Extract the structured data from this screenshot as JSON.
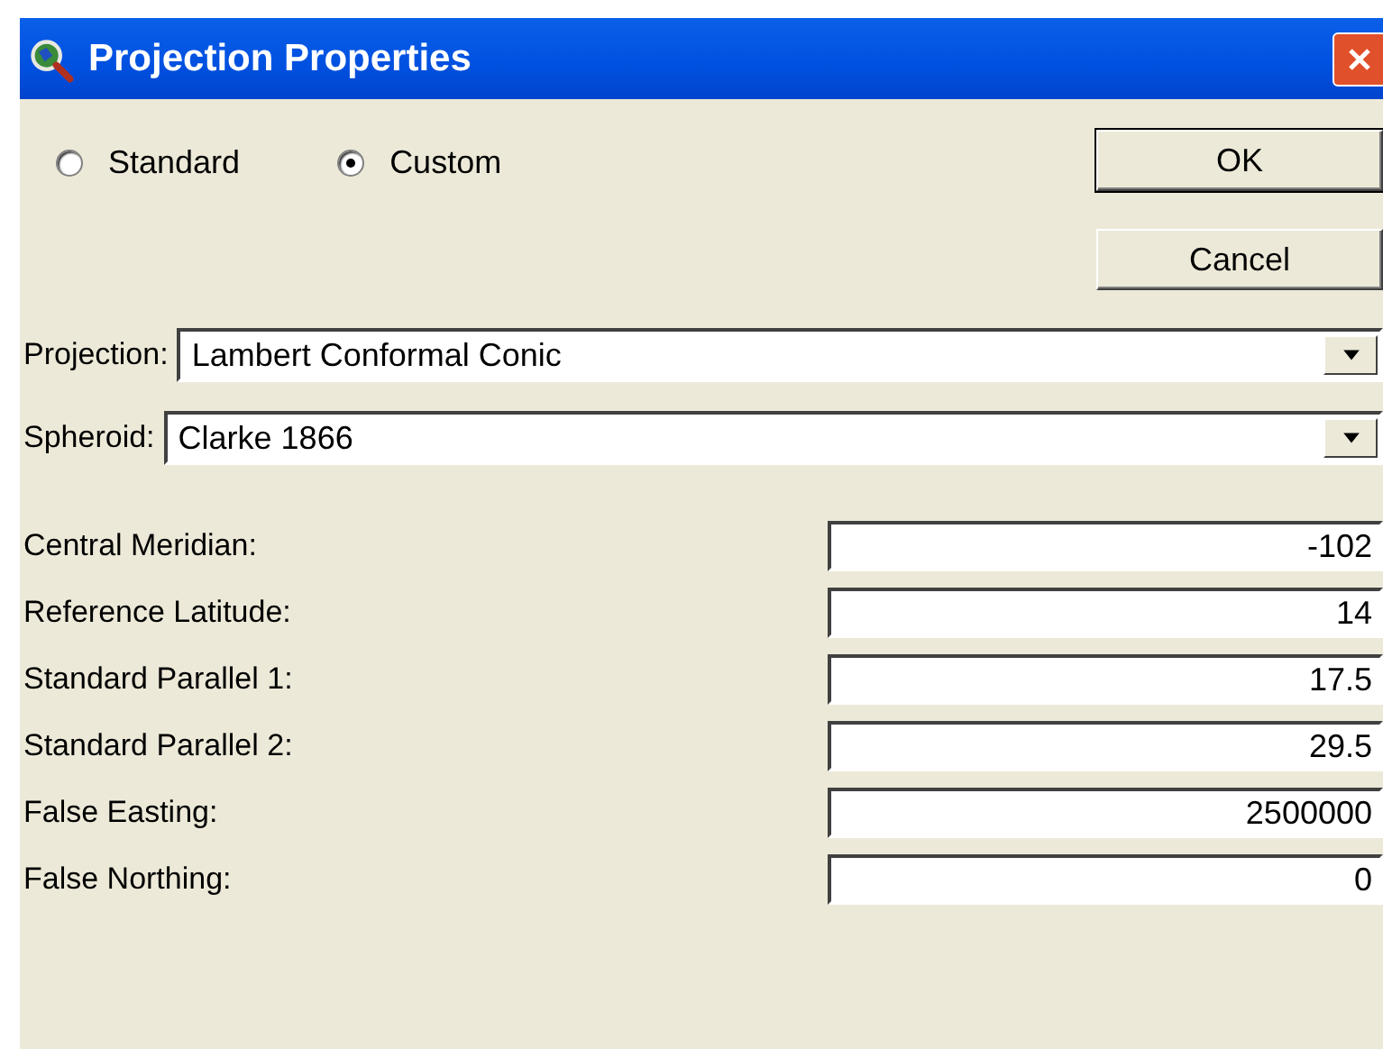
{
  "window": {
    "title": "Projection Properties"
  },
  "mode": [
    {
      "label": "Standard",
      "selected": false
    },
    {
      "label": "Custom",
      "selected": true
    }
  ],
  "buttons": [
    {
      "label": "OK",
      "default": true
    },
    {
      "label": "Cancel",
      "default": false
    }
  ],
  "dropdowns": [
    {
      "label": "Projection:",
      "value": "Lambert Conformal Conic"
    },
    {
      "label": "Spheroid:",
      "value": "Clarke 1866"
    }
  ],
  "parameters": [
    {
      "label": "Central Meridian:",
      "value": "-102"
    },
    {
      "label": "Reference Latitude:",
      "value": "14"
    },
    {
      "label": "Standard Parallel 1:",
      "value": "17.5"
    },
    {
      "label": "Standard Parallel 2:",
      "value": "29.5"
    },
    {
      "label": "False Easting:",
      "value": "2500000"
    },
    {
      "label": "False Northing:",
      "value": "0"
    }
  ]
}
